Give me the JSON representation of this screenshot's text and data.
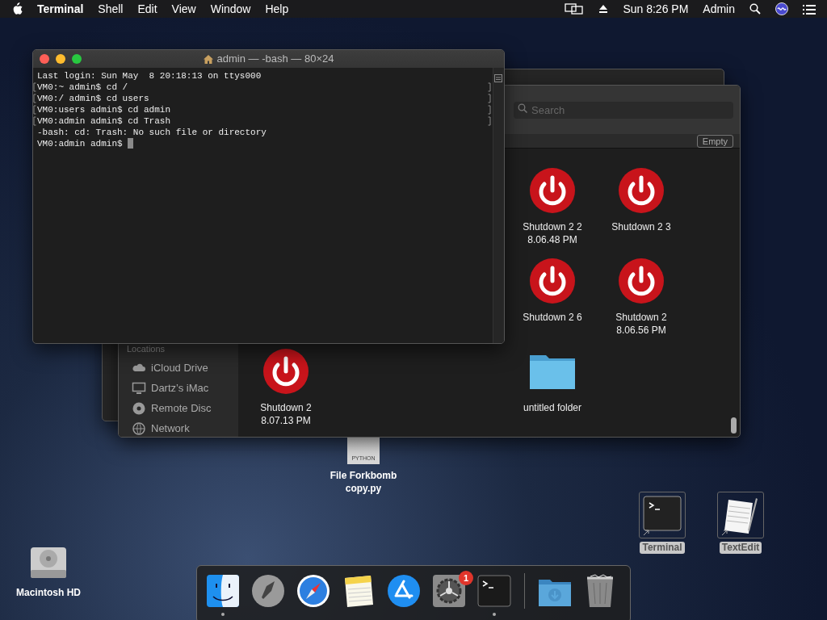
{
  "menubar": {
    "app": "Terminal",
    "menus": [
      "Shell",
      "Edit",
      "View",
      "Window",
      "Help"
    ],
    "clock": "Sun 8:26 PM",
    "user": "Admin"
  },
  "terminal": {
    "title": "admin — -bash — 80×24",
    "cursor": true,
    "lines": [
      {
        "text": "Last login: Sun May  8 20:18:13 on ttys000",
        "marked": false
      },
      {
        "text": "VM0:~ admin$ cd /",
        "marked": true
      },
      {
        "text": "VM0:/ admin$ cd users",
        "marked": true
      },
      {
        "text": "VM0:users admin$ cd admin",
        "marked": true
      },
      {
        "text": "VM0:admin admin$ cd Trash",
        "marked": true
      },
      {
        "text": "-bash: cd: Trash: No such file or directory",
        "marked": false
      },
      {
        "text": "VM0:admin admin$ ",
        "marked": false
      }
    ]
  },
  "finder": {
    "search": {
      "placeholder": "Search"
    },
    "empty_button": "Empty",
    "sidebar": {
      "heading": "Locations",
      "items": [
        {
          "label": "iCloud Drive",
          "kind": "cloud"
        },
        {
          "label": "Dartz’s iMac",
          "kind": "computer"
        },
        {
          "label": "Remote Disc",
          "kind": "disc"
        },
        {
          "label": "Network",
          "kind": "network"
        }
      ]
    },
    "items": [
      {
        "label": "Shutdown 2 2 8.06.48 PM",
        "kind": "shutdown"
      },
      {
        "label": "Shutdown 2 3",
        "kind": "shutdown"
      },
      {
        "label": "Shutdown 2 6",
        "kind": "shutdown"
      },
      {
        "label": "Shutdown 2 8.06.56 PM",
        "kind": "shutdown"
      },
      {
        "label": "Shutdown 2 8.07.13 PM",
        "kind": "shutdown"
      },
      {
        "label": "untitled folder",
        "kind": "folder"
      }
    ]
  },
  "desktop_icons": [
    {
      "label": "File Forkbomb copy.py",
      "kind": "python",
      "tag": "PYTHON"
    },
    {
      "label": "Terminal",
      "kind": "terminal-alias"
    },
    {
      "label": "TextEdit",
      "kind": "textedit-alias"
    },
    {
      "label": "Macintosh HD",
      "kind": "disk"
    }
  ],
  "dock": [
    {
      "kind": "finder",
      "running": true
    },
    {
      "kind": "launchpad",
      "running": false
    },
    {
      "kind": "safari",
      "running": false
    },
    {
      "kind": "notes",
      "running": false
    },
    {
      "kind": "appstore",
      "running": false
    },
    {
      "kind": "settings",
      "running": false,
      "badge": "1"
    },
    {
      "kind": "terminal",
      "running": true
    },
    {
      "kind": "separator",
      "running": false
    },
    {
      "kind": "downloads",
      "running": false
    },
    {
      "kind": "trash",
      "running": false
    }
  ]
}
